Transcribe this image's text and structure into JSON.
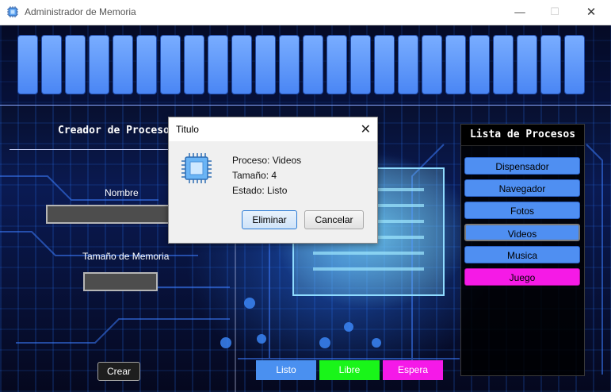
{
  "window": {
    "title": "Administrador de Memoria",
    "minimize_glyph": "—",
    "maximize_glyph": "☐",
    "close_glyph": "✕"
  },
  "memory": {
    "block_count": 23
  },
  "creator": {
    "title": "Creador de Procesos",
    "name_label": "Nombre",
    "name_value": "",
    "size_label": "Tamaño de Memoria",
    "size_value": "",
    "create_label": "Crear"
  },
  "states": {
    "listo": "Listo",
    "libre": "Libre",
    "espera": "Espera"
  },
  "process_list": {
    "title": "Lista de Procesos",
    "items": [
      "Dispensador",
      "Navegador",
      "Fotos",
      "Videos",
      "Musica",
      "Juego"
    ]
  },
  "dialog": {
    "title": "Titulo",
    "close_glyph": "✕",
    "process_line": "Proceso: Videos",
    "size_line": "Tamaño: 4",
    "state_line": "Estado: Listo",
    "delete_label": "Eliminar",
    "cancel_label": "Cancelar"
  },
  "colors": {
    "block_blue": "#5b94f8",
    "listo": "#4a90f0",
    "libre": "#19f519",
    "espera": "#f519e8",
    "proc_blue": "#4f8ff2",
    "proc_selected": "#f51ae6"
  },
  "icons": {
    "app": "memory-chip-icon",
    "dialog": "memory-chip-icon"
  }
}
